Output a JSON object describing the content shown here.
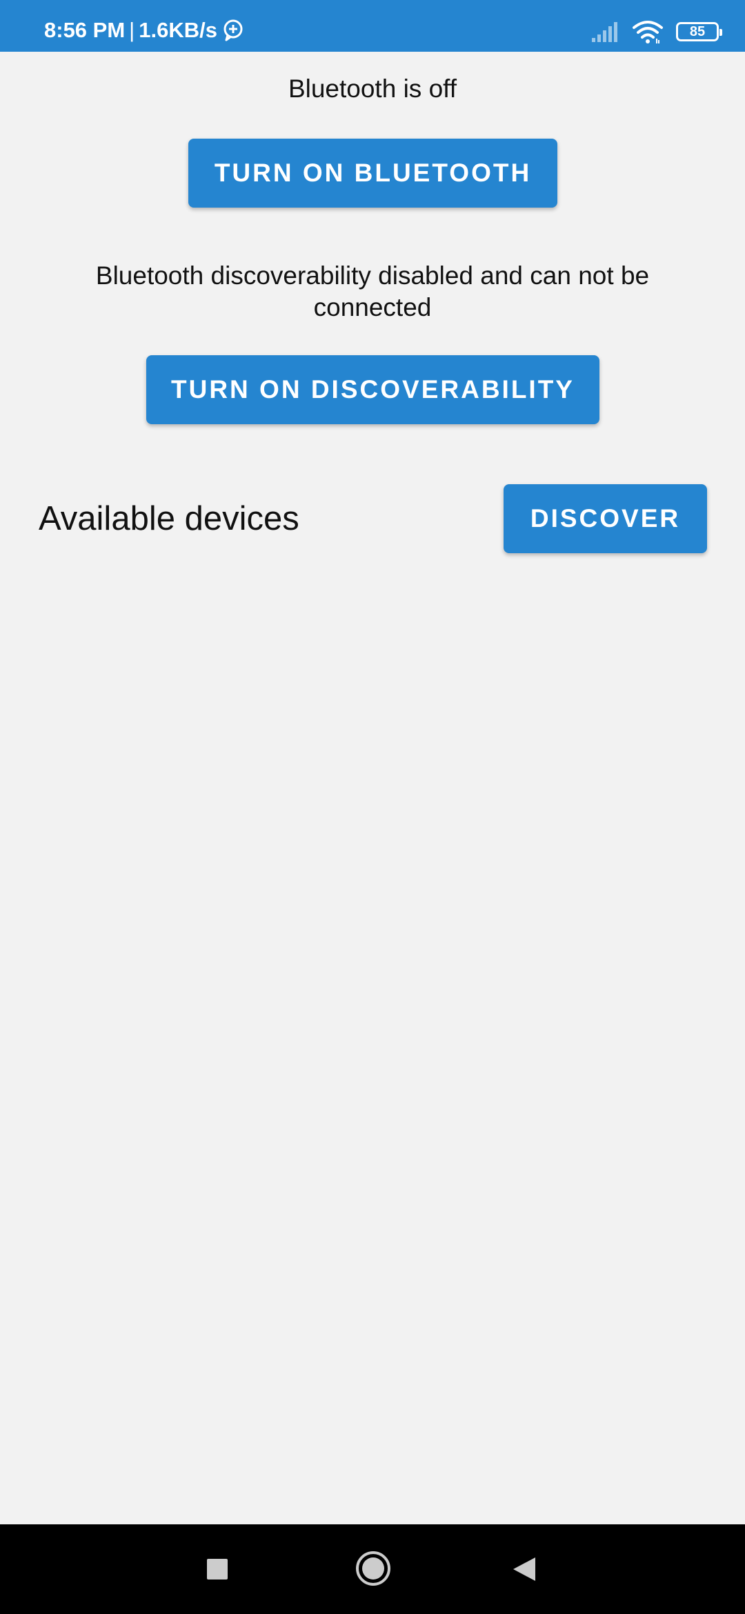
{
  "status_bar": {
    "time": "8:56 PM",
    "separator": "|",
    "speed": "1.6KB/s",
    "battery": "85",
    "icons": [
      "chat-bubble-plus-icon",
      "signal-icon",
      "wifi-icon",
      "battery-icon"
    ],
    "background_color": "#2585d0"
  },
  "bluetooth": {
    "status_text": "Bluetooth is off",
    "turn_on_label": "TURN ON BLUETOOTH"
  },
  "discoverability": {
    "status_text": "Bluetooth discoverability disabled and can not be connected",
    "turn_on_label": "TURN ON DISCOVERABILITY"
  },
  "devices": {
    "title": "Available devices",
    "discover_label": "DISCOVER",
    "items": []
  },
  "nav_bar": {
    "icons": [
      "recent-apps-icon",
      "home-icon",
      "back-icon"
    ]
  },
  "colors": {
    "accent": "#2585d0",
    "background": "#f2f2f2",
    "text": "#111111"
  }
}
